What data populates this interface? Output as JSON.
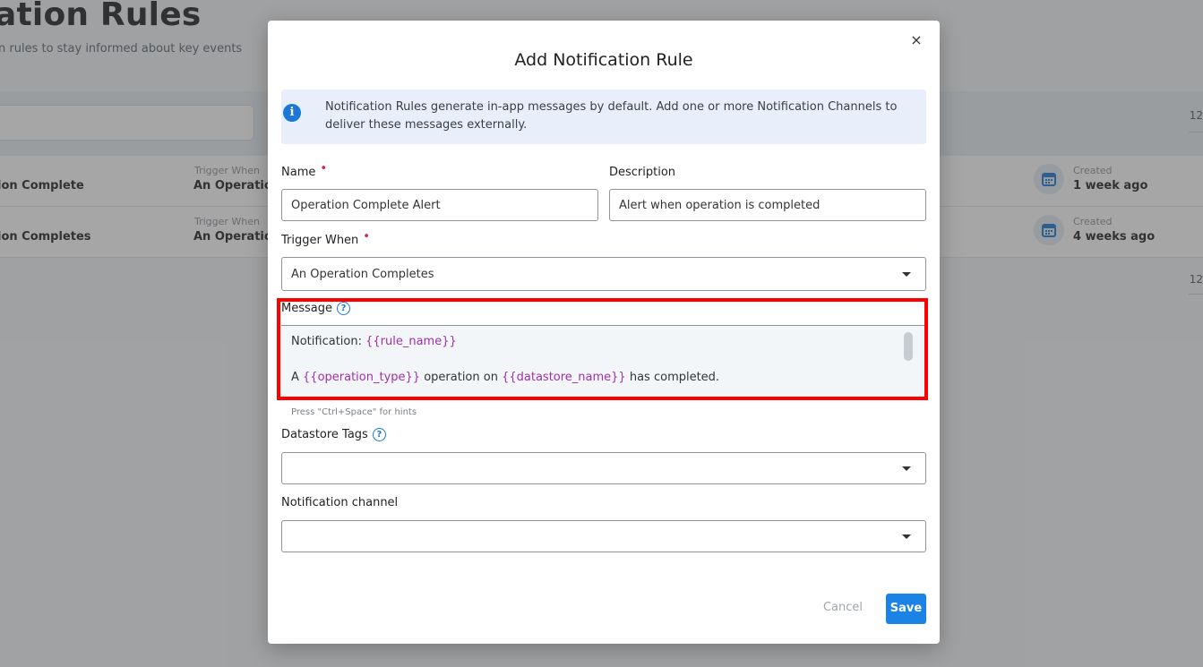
{
  "background": {
    "page_title": "ation Rules",
    "page_subtitle": "n rules to stay informed about key events",
    "count_top": "12",
    "count_bottom": "12",
    "rows": [
      {
        "name": "ion Complete",
        "trigger_label": "Trigger When",
        "trigger_value": "An Operation",
        "created_label": "Created",
        "created_value": "1 week ago"
      },
      {
        "name": "ion Completes",
        "trigger_label": "Trigger When",
        "trigger_value": "An Operation",
        "created_label": "Created",
        "created_value": "4 weeks ago"
      }
    ]
  },
  "modal": {
    "close_glyph": "×",
    "title": "Add Notification Rule",
    "info_icon_glyph": "i",
    "info_text": "Notification Rules generate in-app messages by default. Add one or more Notification Channels to deliver these messages externally.",
    "name": {
      "label": "Name",
      "required_mark": "•",
      "value": "Operation Complete Alert"
    },
    "description": {
      "label": "Description",
      "value": "Alert when operation is completed"
    },
    "trigger": {
      "label": "Trigger When",
      "required_mark": "•",
      "value": "An Operation Completes"
    },
    "message": {
      "label": "Message",
      "help_glyph": "?",
      "line1_prefix": "Notification: ",
      "line1_var": "{{rule_name}}",
      "line2_a": "A ",
      "line2_var1": "{{operation_type}}",
      "line2_b": " operation on ",
      "line2_var2": "{{datastore_name}}",
      "line2_c": " has completed.",
      "hint": "Press \"Ctrl+Space\" for hints"
    },
    "datastore_tags": {
      "label": "Datastore Tags",
      "help_glyph": "?",
      "value": ""
    },
    "notification_channel": {
      "label": "Notification channel",
      "value": ""
    },
    "cancel_label": "Cancel",
    "save_label": "Save"
  },
  "colors": {
    "accent": "#1b82e6",
    "variable": "#a130a8",
    "required": "#d3244a",
    "highlight": "#ff0000",
    "info_bg": "#e8effb"
  }
}
